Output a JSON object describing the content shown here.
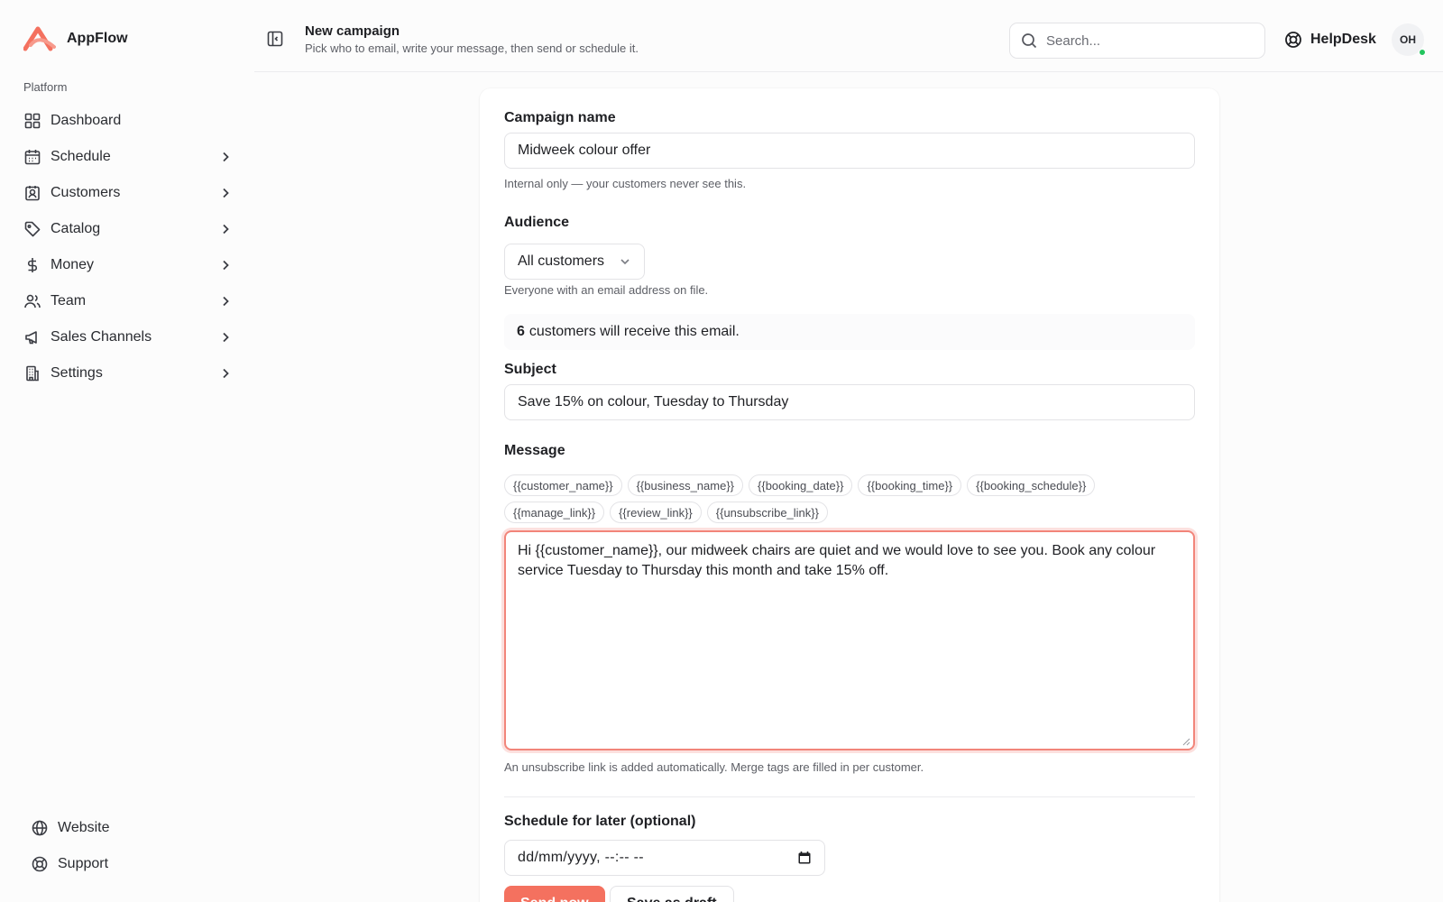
{
  "app": {
    "name": "AppFlow"
  },
  "sidebar": {
    "section": "Platform",
    "items": [
      {
        "label": "Dashboard",
        "icon": "dashboard-grid-icon",
        "chevron": false
      },
      {
        "label": "Schedule",
        "icon": "calendar-icon",
        "chevron": true
      },
      {
        "label": "Customers",
        "icon": "contact-card-icon",
        "chevron": true
      },
      {
        "label": "Catalog",
        "icon": "tag-icon",
        "chevron": true
      },
      {
        "label": "Money",
        "icon": "dollar-icon",
        "chevron": true
      },
      {
        "label": "Team",
        "icon": "users-icon",
        "chevron": true
      },
      {
        "label": "Sales Channels",
        "icon": "megaphone-icon",
        "chevron": true
      },
      {
        "label": "Settings",
        "icon": "building-icon",
        "chevron": true
      }
    ],
    "bottom": [
      {
        "label": "Website",
        "icon": "globe-icon"
      },
      {
        "label": "Support",
        "icon": "lifebuoy-icon"
      }
    ]
  },
  "header": {
    "title": "New campaign",
    "subtitle": "Pick who to email, write your message, then send or schedule it.",
    "search_placeholder": "Search...",
    "helpdesk_label": "HelpDesk",
    "avatar_initials": "OH"
  },
  "form": {
    "campaign_name": {
      "label": "Campaign name",
      "value": "Midweek colour offer",
      "hint": "Internal only — your customers never see this."
    },
    "audience": {
      "label": "Audience",
      "selected": "All customers",
      "hint": "Everyone with an email address on file.",
      "recipient_count": "6",
      "recipient_text": "customers will receive this email."
    },
    "subject": {
      "label": "Subject",
      "value": "Save 15% on colour, Tuesday to Thursday"
    },
    "message": {
      "label": "Message",
      "merge_tags": [
        "{{customer_name}}",
        "{{business_name}}",
        "{{booking_date}}",
        "{{booking_time}}",
        "{{booking_schedule}}",
        "{{manage_link}}",
        "{{review_link}}",
        "{{unsubscribe_link}}"
      ],
      "value": "Hi {{customer_name}}, our midweek chairs are quiet and we would love to see you. Book any colour service Tuesday to Thursday this month and take 15% off.",
      "hint": "An unsubscribe link is added automatically. Merge tags are filled in per customer."
    },
    "schedule": {
      "label": "Schedule for later (optional)",
      "placeholder": "dd/mm/yyyy, --:-- --"
    },
    "actions": {
      "send_label": "Send now",
      "draft_label": "Save as draft"
    }
  },
  "colors": {
    "accent": "#f4715f",
    "focus_border": "#f2857a",
    "status_online": "#23c55e"
  }
}
